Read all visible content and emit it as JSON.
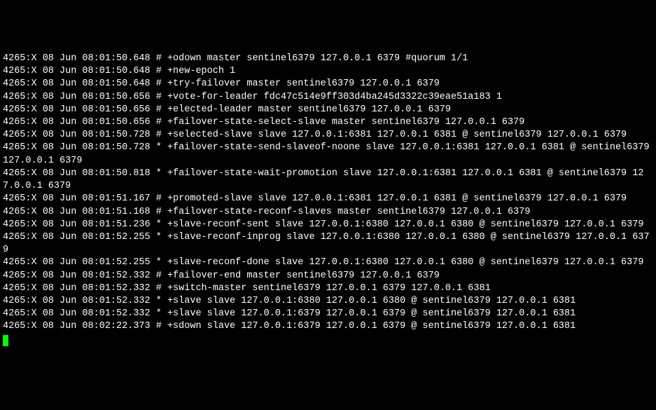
{
  "log_lines": [
    "4265:X 08 Jun 08:01:50.648 # +odown master sentinel6379 127.0.0.1 6379 #quorum 1/1",
    "4265:X 08 Jun 08:01:50.648 # +new-epoch 1",
    "4265:X 08 Jun 08:01:50.648 # +try-failover master sentinel6379 127.0.0.1 6379",
    "4265:X 08 Jun 08:01:50.656 # +vote-for-leader fdc47c514e9ff303d4ba245d3322c39eae51a183 1",
    "4265:X 08 Jun 08:01:50.656 # +elected-leader master sentinel6379 127.0.0.1 6379",
    "4265:X 08 Jun 08:01:50.656 # +failover-state-select-slave master sentinel6379 127.0.0.1 6379",
    "4265:X 08 Jun 08:01:50.728 # +selected-slave slave 127.0.0.1:6381 127.0.0.1 6381 @ sentinel6379 127.0.0.1 6379",
    "4265:X 08 Jun 08:01:50.728 * +failover-state-send-slaveof-noone slave 127.0.0.1:6381 127.0.0.1 6381 @ sentinel6379 127.0.0.1 6379",
    "4265:X 08 Jun 08:01:50.818 * +failover-state-wait-promotion slave 127.0.0.1:6381 127.0.0.1 6381 @ sentinel6379 127.0.0.1 6379",
    "4265:X 08 Jun 08:01:51.167 # +promoted-slave slave 127.0.0.1:6381 127.0.0.1 6381 @ sentinel6379 127.0.0.1 6379",
    "4265:X 08 Jun 08:01:51.168 # +failover-state-reconf-slaves master sentinel6379 127.0.0.1 6379",
    "4265:X 08 Jun 08:01:51.236 * +slave-reconf-sent slave 127.0.0.1:6380 127.0.0.1 6380 @ sentinel6379 127.0.0.1 6379",
    "4265:X 08 Jun 08:01:52.255 * +slave-reconf-inprog slave 127.0.0.1:6380 127.0.0.1 6380 @ sentinel6379 127.0.0.1 6379",
    "4265:X 08 Jun 08:01:52.255 * +slave-reconf-done slave 127.0.0.1:6380 127.0.0.1 6380 @ sentinel6379 127.0.0.1 6379",
    "4265:X 08 Jun 08:01:52.332 # +failover-end master sentinel6379 127.0.0.1 6379",
    "4265:X 08 Jun 08:01:52.332 # +switch-master sentinel6379 127.0.0.1 6379 127.0.0.1 6381",
    "4265:X 08 Jun 08:01:52.332 * +slave slave 127.0.0.1:6380 127.0.0.1 6380 @ sentinel6379 127.0.0.1 6381",
    "4265:X 08 Jun 08:01:52.332 * +slave slave 127.0.0.1:6379 127.0.0.1 6379 @ sentinel6379 127.0.0.1 6381",
    "4265:X 08 Jun 08:02:22.373 # +sdown slave 127.0.0.1:6379 127.0.0.1 6379 @ sentinel6379 127.0.0.1 6381"
  ]
}
